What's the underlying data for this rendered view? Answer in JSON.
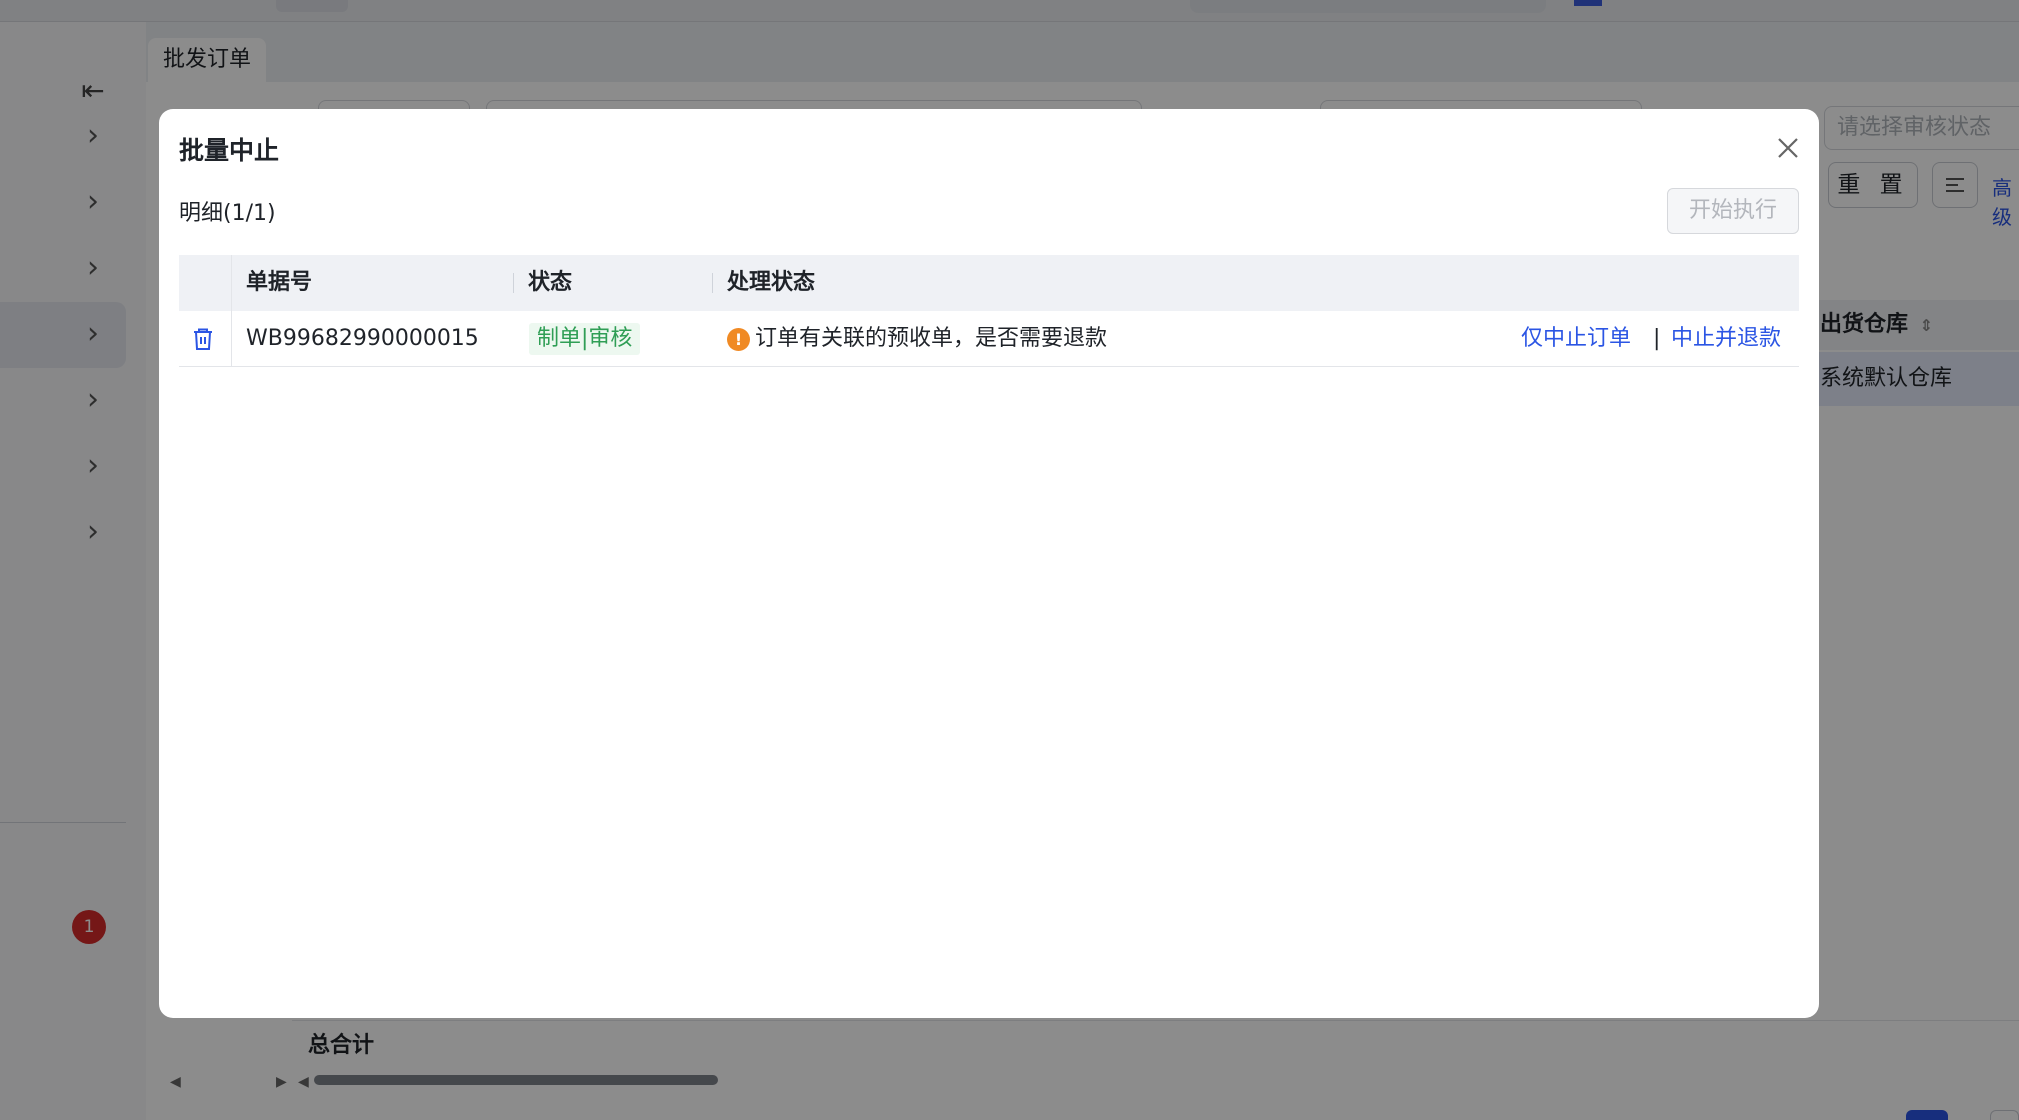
{
  "tab": {
    "label": "批发订单"
  },
  "sidebar": {
    "badge_count": "1"
  },
  "filters": {
    "audit_status_placeholder": "请选择审核状态",
    "reset_label": "重 置",
    "advanced_label": "高级"
  },
  "table_bg": {
    "column_warehouse": "出货仓库",
    "warehouse_value": "系统默认仓库",
    "total_label": "总合计"
  },
  "modal": {
    "title": "批量中止",
    "detail_label": "明细(1/1)",
    "start_button": "开始执行",
    "columns": [
      "单据号",
      "状态",
      "处理状态"
    ],
    "rows": [
      {
        "doc_no": "WB99682990000015",
        "status": "制单|审核",
        "process_status": "订单有关联的预收单，是否需要退款",
        "action_stop_only": "仅中止订单",
        "action_separator": "|",
        "action_stop_refund": "中止并退款"
      }
    ]
  },
  "colors": {
    "accent": "#2b55e4",
    "status_tag_bg": "#edf8f0",
    "status_tag_text": "#2f9e55",
    "warning": "#f08a24",
    "badge": "#d62b2b"
  },
  "icons": {
    "close": "close-icon",
    "delete_row": "trash-icon",
    "warning": "warning-icon",
    "collapse": "collapse-sidebar-icon",
    "chevron": "chevron-right-icon",
    "filter": "filter-list-icon",
    "sort": "sort-icon"
  }
}
